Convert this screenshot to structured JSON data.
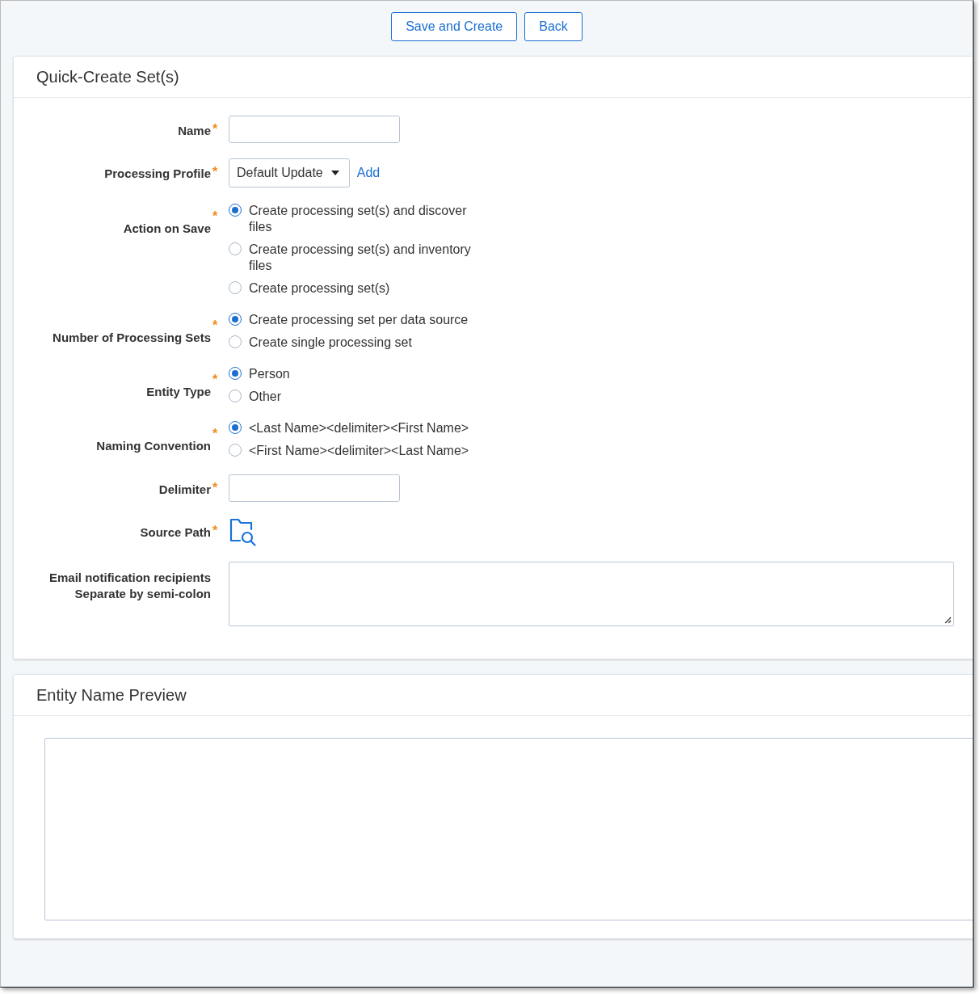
{
  "toolbar": {
    "buttons": [
      {
        "label": "Save and Create"
      },
      {
        "label": "Back"
      }
    ]
  },
  "form_card": {
    "title": "Quick-Create Set(s)",
    "fields": [
      {
        "kind": "text",
        "label": "Name",
        "required_mark": "*"
      },
      {
        "kind": "select",
        "label": "Processing Profile",
        "required_mark": "*",
        "value": "Default Update",
        "link": "Add"
      },
      {
        "kind": "radio",
        "label": "Action on Save",
        "required_mark": "*",
        "options": [
          {
            "label": "Create processing set(s) and discover files",
            "selected": true
          },
          {
            "label": "Create processing set(s) and inventory files",
            "selected": false
          },
          {
            "label": "Create processing set(s)",
            "selected": false
          }
        ]
      },
      {
        "kind": "radio",
        "label": "Number of Processing Sets",
        "required_mark": "*",
        "options": [
          {
            "label": "Create processing set per data source",
            "selected": true
          },
          {
            "label": "Create single processing set",
            "selected": false
          }
        ]
      },
      {
        "kind": "radio",
        "label": "Entity Type",
        "required_mark": "*",
        "options": [
          {
            "label": "Person",
            "selected": true
          },
          {
            "label": "Other",
            "selected": false
          }
        ]
      },
      {
        "kind": "radio",
        "label": "Naming Convention",
        "required_mark": "*",
        "options": [
          {
            "label": "<Last Name><delimiter><First Name>",
            "selected": true
          },
          {
            "label": "<First Name><delimiter><Last Name>",
            "selected": false
          }
        ]
      },
      {
        "kind": "text",
        "label": "Delimiter",
        "required_mark": "*"
      },
      {
        "kind": "folder",
        "label": "Source Path",
        "required_mark": "*"
      },
      {
        "kind": "textarea",
        "label": "Email notification recipients",
        "hint": "Separate by semi-colon"
      }
    ]
  },
  "preview_card": {
    "title": "Entity Name Preview"
  }
}
